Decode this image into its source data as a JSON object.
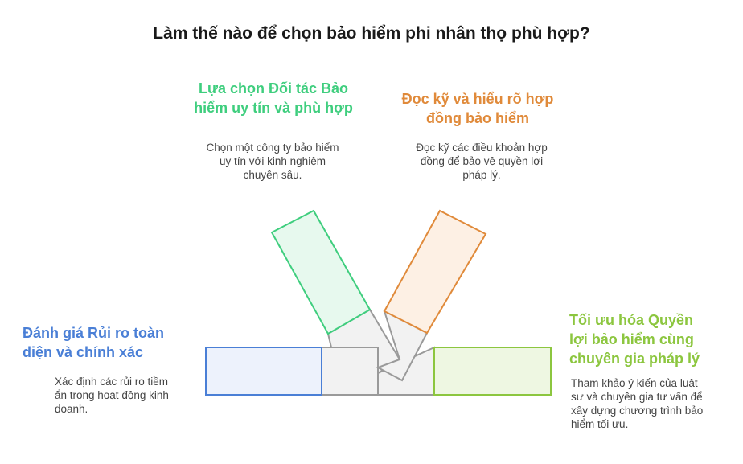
{
  "title": "Làm thế nào để chọn bảo hiểm phi nhân thọ phù hợp?",
  "items": [
    {
      "heading": "Đánh giá Rủi ro toàn diện và chính xác",
      "heading_lines": [
        "Đánh giá Rủi ro toàn",
        "diện và chính xác"
      ],
      "desc_lines": [
        "Xác định các rủi ro tiềm",
        "ẩn trong hoạt động kinh",
        "doanh."
      ],
      "color": "#4a7fd6",
      "fill": "#edf2fc"
    },
    {
      "heading": "Lựa chọn Đối tác Bảo hiểm uy tín và phù hợp",
      "heading_lines": [
        "Lựa chọn Đối tác Bảo",
        "hiểm uy tín và phù hợp"
      ],
      "desc_lines": [
        "Chọn một công ty bảo hiểm",
        "uy tín với kinh nghiệm",
        "chuyên sâu."
      ],
      "color": "#3fce7e",
      "fill": "#e7f9ee"
    },
    {
      "heading": "Đọc kỹ và hiểu rõ hợp đồng bảo hiểm",
      "heading_lines": [
        "Đọc kỹ và hiểu rõ hợp",
        "đồng bảo hiểm"
      ],
      "desc_lines": [
        "Đọc kỹ các điều khoản hợp",
        "đồng để bảo vệ quyền lợi",
        "pháp lý."
      ],
      "color": "#e08a3a",
      "fill": "#fdf0e4"
    },
    {
      "heading": "Tối ưu hóa Quyền lợi bảo hiểm cùng chuyên gia pháp lý",
      "heading_lines": [
        "Tối ưu hóa Quyền",
        "lợi bảo hiểm cùng",
        "chuyên gia pháp lý"
      ],
      "desc_lines": [
        "Tham khảo ý kiến của luật",
        "sư và chuyên gia tư vấn để",
        "xây dựng chương trình bảo",
        "hiểm tối ưu."
      ],
      "color": "#8cc63f",
      "fill": "#eef7e2"
    }
  ],
  "hub": {
    "stroke": "#9a9a9a",
    "fill": "#f2f2f2"
  }
}
